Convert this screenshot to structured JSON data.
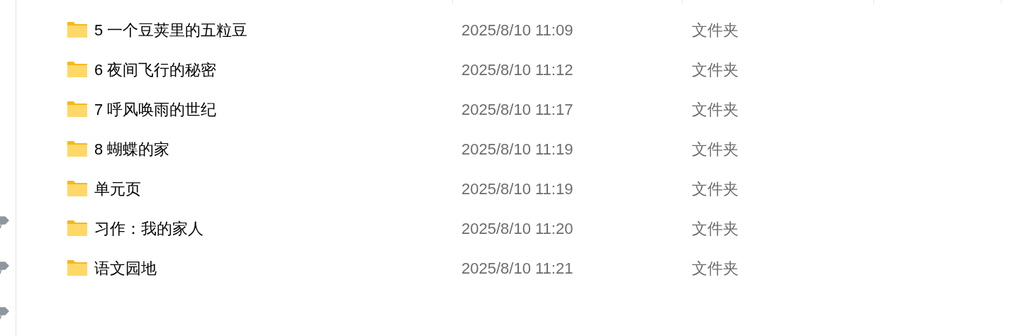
{
  "sidebar": {
    "pinned_items": [
      {
        "pinned": true
      },
      {
        "pinned": true
      },
      {
        "pinned": true
      }
    ]
  },
  "files": [
    {
      "name": "5 一个豆荚里的五粒豆",
      "modified": "2025/8/10 11:09",
      "type": "文件夹"
    },
    {
      "name": "6 夜间飞行的秘密",
      "modified": "2025/8/10 11:12",
      "type": "文件夹"
    },
    {
      "name": "7 呼风唤雨的世纪",
      "modified": "2025/8/10 11:17",
      "type": "文件夹"
    },
    {
      "name": "8 蝴蝶的家",
      "modified": "2025/8/10 11:19",
      "type": "文件夹"
    },
    {
      "name": "单元页",
      "modified": "2025/8/10 11:19",
      "type": "文件夹"
    },
    {
      "name": "习作：我的家人",
      "modified": "2025/8/10 11:20",
      "type": "文件夹"
    },
    {
      "name": "语文园地",
      "modified": "2025/8/10 11:21",
      "type": "文件夹"
    }
  ]
}
